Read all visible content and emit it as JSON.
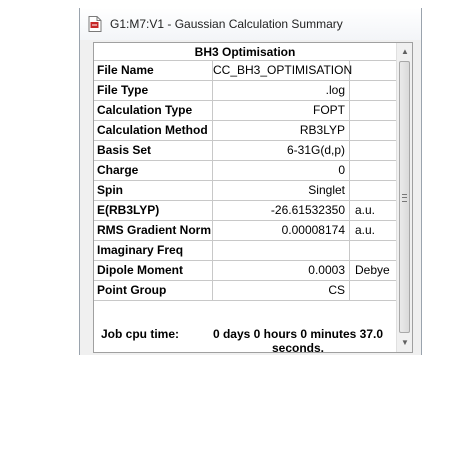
{
  "window": {
    "title": "G1:M7:V1 - Gaussian Calculation Summary",
    "icon": "gaussian-document-icon"
  },
  "summary": {
    "header": "BH3 Optimisation",
    "rows": [
      {
        "label": "File Name",
        "value": "CC_BH3_OPTIMISATION",
        "unit": ""
      },
      {
        "label": "File Type",
        "value": ".log",
        "unit": ""
      },
      {
        "label": "Calculation Type",
        "value": "FOPT",
        "unit": ""
      },
      {
        "label": "Calculation Method",
        "value": "RB3LYP",
        "unit": ""
      },
      {
        "label": "Basis Set",
        "value": "6-31G(d,p)",
        "unit": ""
      },
      {
        "label": "Charge",
        "value": "0",
        "unit": ""
      },
      {
        "label": "Spin",
        "value": "Singlet",
        "unit": ""
      },
      {
        "label": "E(RB3LYP)",
        "value": "-26.61532350",
        "unit": "a.u."
      },
      {
        "label": "RMS Gradient Norm",
        "value": "0.00008174",
        "unit": "a.u."
      },
      {
        "label": "Imaginary Freq",
        "value": "",
        "unit": ""
      },
      {
        "label": "Dipole Moment",
        "value": "0.0003",
        "unit": "Debye"
      },
      {
        "label": "Point Group",
        "value": "CS",
        "unit": ""
      }
    ],
    "job_cpu_label": "Job cpu time:",
    "job_cpu_value": "0 days  0 hours  0 minutes 37.0 seconds."
  },
  "scrollbar": {
    "up_icon": "chevron-up-icon",
    "down_icon": "chevron-down-icon"
  }
}
